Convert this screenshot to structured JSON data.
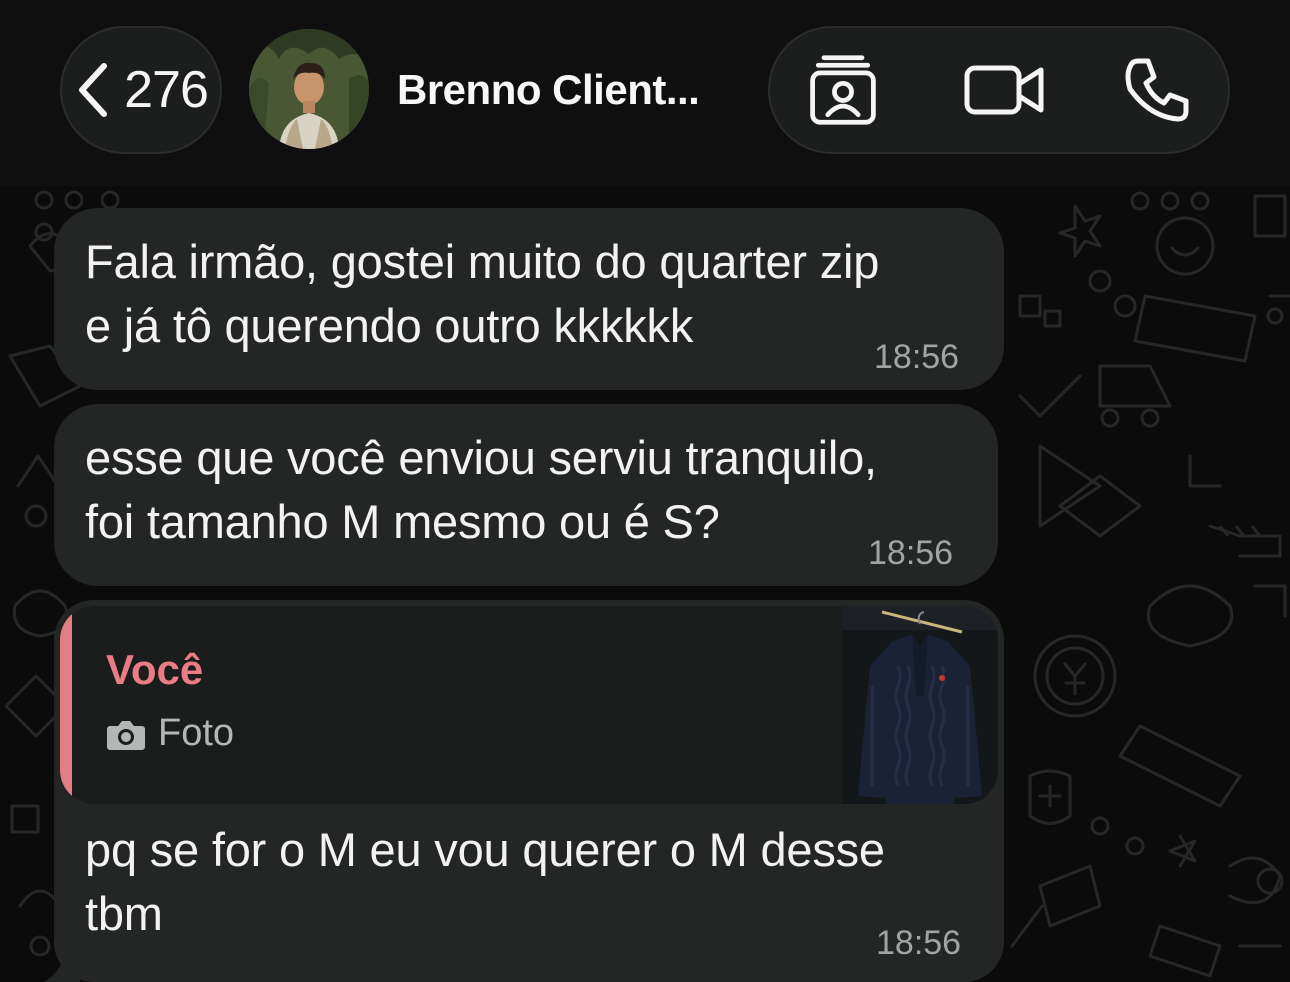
{
  "header": {
    "back_count": "276",
    "contact_name": "Brenno Client...",
    "icons": [
      "chevron-left-icon",
      "contact-card-icon",
      "video-camera-icon",
      "phone-icon"
    ]
  },
  "messages": [
    {
      "lines": [
        "Fala irmão, gostei muito do quarter zip",
        "e já tô querendo outro kkkkkk"
      ],
      "time": "18:56"
    },
    {
      "lines": [
        "esse que você enviou serviu tranquilo,",
        "foi tamanho M mesmo ou é S?"
      ],
      "time": "18:56"
    },
    {
      "reply": {
        "author": "Você",
        "media_label": "Foto",
        "media_icon": "camera-icon"
      },
      "lines": [
        "pq se for o M eu vou querer o M desse",
        "tbm"
      ],
      "time": "18:56"
    }
  ],
  "colors": {
    "background": "#0b0b0b",
    "header": "#0f0f0f",
    "bubble": "#242626",
    "quote_accent": "#e57d85",
    "timestamp": "#a2a4a4"
  }
}
